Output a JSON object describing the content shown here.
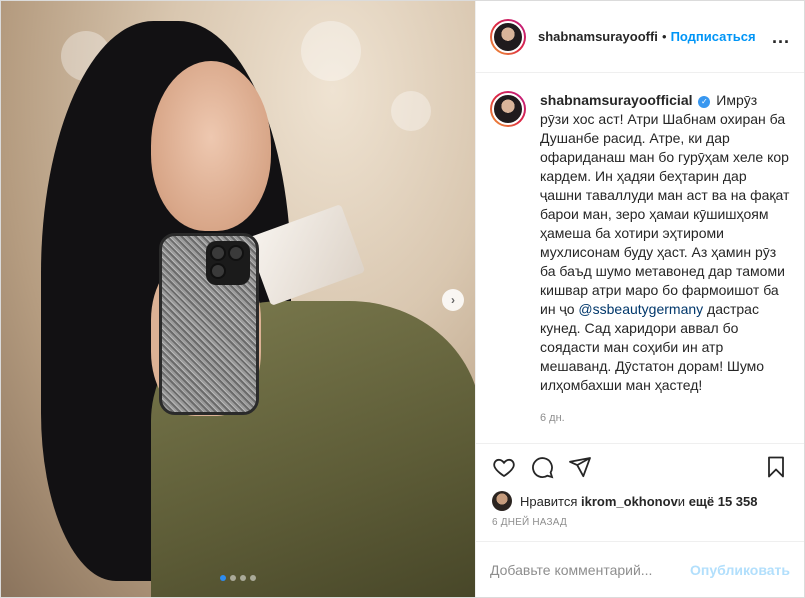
{
  "header": {
    "username": "shabnamsurayoofficial",
    "separator": "•",
    "follow_label": "Подписаться",
    "more_label": "..."
  },
  "caption": {
    "username": "shabnamsurayoofficial",
    "verified_mark": "✓",
    "text_before_mention": "Имрӯз рӯзи хос аст! Атри Шабнам охиран ба Душанбе расид. Атре, ки дар офариданаш ман бо гурӯҳам хеле кор кардем. Ин ҳадяи беҳтарин дар ҷашни таваллуди ман аст ва на фақат барои ман, зеро ҳамаи кӯшишҳоям ҳамеша ба хотири эҳтироми мухлисонам буду ҳаст. Аз ҳамин рӯз ба баъд шумо метавонед дар тамоми кишвар атри маро бо фармоишот ба ин ҷо",
    "mention": "@ssbeautygermany",
    "text_after_mention": " дастрас кунед. Сад харидори аввал бо соядасти ман соҳиби ин атр мешаванд. Дӯстатон дорам! Шумо илҳомбахши ман ҳастед!",
    "time_ago": "6 дн."
  },
  "actions": {
    "like_icon": "heart-icon",
    "comment_icon": "comment-icon",
    "share_icon": "share-icon",
    "save_icon": "bookmark-icon"
  },
  "likes": {
    "prefix": "Нравится ",
    "user": "ikrom_okhonov",
    "middle": " и ",
    "count": "ещё 15 358"
  },
  "post_date": "6 ДНЕЙ НАЗАД",
  "comment": {
    "placeholder": "Добавьте комментарий...",
    "post_label": "Опубликовать"
  },
  "carousel": {
    "next_label": "›",
    "total_slides": 4,
    "active_slide": 1
  },
  "colors": {
    "accent": "#0095f6",
    "mention": "#00376b",
    "verified": "#3897f0",
    "post_disabled": "#b2dffc"
  }
}
